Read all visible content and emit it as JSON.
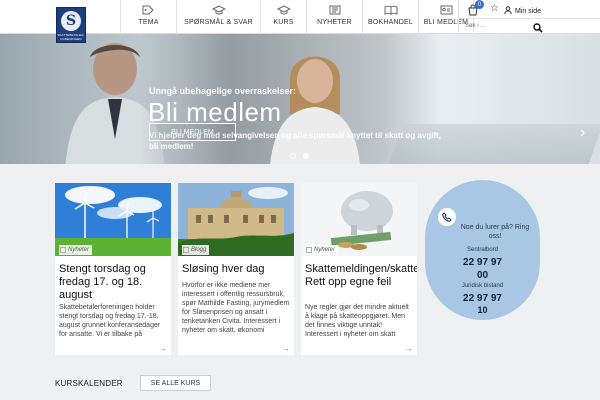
{
  "logo": {
    "mark": "S",
    "text": "SKATTEBETALER-\nFORENINGEN"
  },
  "nav": [
    {
      "label": "TEMA",
      "icon": "tags-icon"
    },
    {
      "label": "SPØRSMÅL & SVAR",
      "icon": "graduation-cap-icon"
    },
    {
      "label": "KURS",
      "icon": "graduation-cap-icon"
    },
    {
      "label": "NYHETER",
      "icon": "newspaper-icon"
    },
    {
      "label": "BOKHANDEL",
      "icon": "book-icon"
    },
    {
      "label": "BLI MEDLEM",
      "icon": "id-card-icon"
    }
  ],
  "util": {
    "cart_count": "0",
    "user_label": "Min side",
    "search_placeholder": "Søk i ..."
  },
  "hero": {
    "kicker": "Unngå ubehagelige overraskelser:",
    "title": "Bli medlem",
    "subtitle": "Vi hjelper deg med selvangivelsen og alle spørsmål knyttet til skatt og avgift, bli medlem!",
    "button": "BLI MEDLEM"
  },
  "cards": [
    {
      "tag": "Nyheter",
      "title": "Stengt torsdag og fredag 17. og 18. august",
      "text": "Skattebetalerforeningen holder stengt torsdag og fredag 17.-18. august grunnet konferansedager for ansatte. Vi er tilbake på mandag som"
    },
    {
      "tag": "Blogg",
      "title": "Sløsing hver dag",
      "text": "Hvorfor er ikke mediene mer interessert i offentlig ressursbruk, spør Mathilde Fasting, jurymedlem for Sløseriprisen og ansatt i tenketanken Civita. Interessert i nyheter om skatt, økonomi"
    },
    {
      "tag": "Nyheter",
      "title": "Skattemeldingen/skatteoppgjøret: Rett opp egne feil",
      "text": "Nye regler gjør det mindre aktuelt å klage på skatteoppgjøret. Men det finnes viktige unntak! Interessert i nyheter om skatt"
    }
  ],
  "contact": {
    "question": "Noe du lurer på? Ring oss!",
    "label1": "Sentralbord",
    "number1_a": "22 97 97",
    "number1_b": "00",
    "label2": "Juridisk bistand",
    "number2_a": "22 97 97",
    "number2_b": "10"
  },
  "kurs": {
    "label": "KURSKALENDER",
    "button": "SE ALLE KURS"
  }
}
